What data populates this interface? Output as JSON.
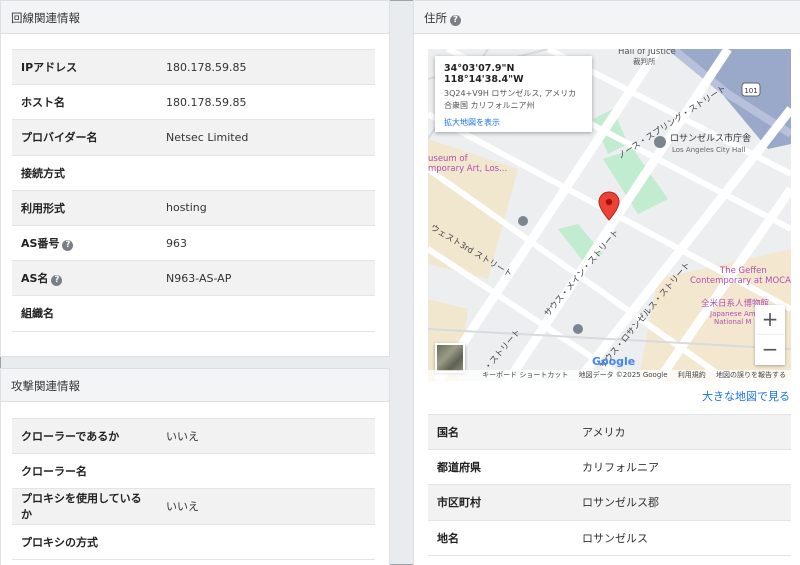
{
  "line_section": {
    "title": "回線関連情報",
    "rows": [
      {
        "label": "IPアドレス",
        "value": "180.178.59.85"
      },
      {
        "label": "ホスト名",
        "value": "180.178.59.85"
      },
      {
        "label": "プロバイダー名",
        "value": "Netsec Limited"
      },
      {
        "label": "接続方式",
        "value": ""
      },
      {
        "label": "利用形式",
        "value": "hosting"
      },
      {
        "label": "AS番号",
        "value": "963"
      },
      {
        "label": "AS名",
        "value": "N963-AS-AP"
      },
      {
        "label": "組織名",
        "value": ""
      }
    ]
  },
  "attack_section": {
    "title": "攻撃関連情報",
    "rows": [
      {
        "label": "クローラーであるか",
        "value": "いいえ"
      },
      {
        "label": "クローラー名",
        "value": ""
      },
      {
        "label": "プロキシを使用しているか",
        "value": "いいえ"
      },
      {
        "label": "プロキシの方式",
        "value": ""
      }
    ]
  },
  "address_section": {
    "title": "住所",
    "help_glyph": "?",
    "map": {
      "coords": "34°03'07.9\"N 118°14'38.4\"W",
      "address": "3Q24+V9H ロサンゼルス, アメリカ合衆国 カリフォルニア州",
      "enlarge_link": "拡大地図を表示",
      "zoom_in": "+",
      "zoom_out": "−",
      "google_logo": "Google",
      "attribution": [
        "キーボード ショートカット",
        "地図データ ©2025 Google",
        "利用規約",
        "地図の誤りを報告する"
      ],
      "labels": {
        "hall_of_justice": "Hall of Justice",
        "hall_of_justice_ja": "裁判所",
        "city_hall_ja": "ロサンゼルス市庁舎",
        "city_hall_en": "Los Angeles City Hall",
        "museum": "useum of\nmporary Art, Los...",
        "geffen": "The Geffen\nContemporary at MOCA",
        "japanese_museum": "全米日系人博物館",
        "japanese_museum_en": "Japanese Ame\nNational M",
        "north_spring": "ノース・スプリング・ストリート",
        "west_3rd": "ウェスト3rd ストリート",
        "south_main": "サウス・メイン・ストリート",
        "south_la": "サウス・ロサンゼルス・ストリート",
        "street_sw": "・ストリート",
        "highway": "101"
      }
    },
    "big_map_link": "大きな地図で見る",
    "rows": [
      {
        "label": "国名",
        "value": "アメリカ"
      },
      {
        "label": "都道府県",
        "value": "カリフォルニア"
      },
      {
        "label": "市区町村",
        "value": "ロサンゼルス郡"
      },
      {
        "label": "地名",
        "value": "ロサンゼルス"
      }
    ]
  },
  "colors": {
    "link": "#1a73e8",
    "pin": "#ea4335",
    "park": "#c2ecd0",
    "water_blue": "#9aa8c9"
  }
}
